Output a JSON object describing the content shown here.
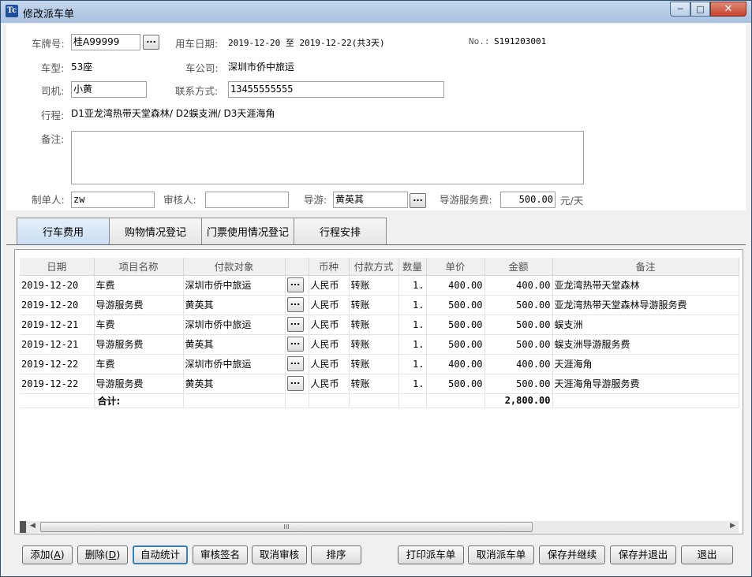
{
  "window": {
    "title": "修改派车单",
    "app_icon": "Tc"
  },
  "form": {
    "plate_label": "车牌号:",
    "plate_value": "桂A99999",
    "date_label": "用车日期:",
    "date_value": "2019-12-20 至 2019-12-22(共3天)",
    "no_label": "No.:",
    "no_value": "S191203001",
    "car_type_label": "车型:",
    "car_type_value": "53座",
    "company_label": "车公司:",
    "company_value": "深圳市侨中旅运",
    "driver_label": "司机:",
    "driver_value": "小黄",
    "contact_label": "联系方式:",
    "contact_value": "13455555555",
    "itinerary_label": "行程:",
    "itinerary_value": "D1亚龙湾热带天堂森林/ D2蜈支洲/ D3天涯海角",
    "remark_label": "备注:",
    "remark_value": "",
    "maker_label": "制单人:",
    "maker_value": "zw",
    "reviewer_label": "审核人:",
    "reviewer_value": "",
    "guide_label": "导游:",
    "guide_value": "黄英其",
    "guide_fee_label": "导游服务费:",
    "guide_fee_value": "500.00",
    "guide_fee_unit": "元/天",
    "ellipsis": "..."
  },
  "tabs": [
    {
      "label": "行车费用",
      "active": true
    },
    {
      "label": "购物情况登记",
      "active": false
    },
    {
      "label": "门票使用情况登记",
      "active": false
    },
    {
      "label": "行程安排",
      "active": false
    }
  ],
  "grid": {
    "columns": [
      "日期",
      "项目名称",
      "付款对象",
      "",
      "币种",
      "付款方式",
      "数量",
      "单价",
      "金额",
      "备注"
    ],
    "rows": [
      [
        "2019-12-20",
        "车费",
        "深圳市侨中旅运",
        "...",
        "人民币",
        "转账",
        "1.",
        "400.00",
        "400.00",
        "亚龙湾热带天堂森林"
      ],
      [
        "2019-12-20",
        "导游服务费",
        "黄英其",
        "...",
        "人民币",
        "转账",
        "1.",
        "500.00",
        "500.00",
        "亚龙湾热带天堂森林导游服务费"
      ],
      [
        "2019-12-21",
        "车费",
        "深圳市侨中旅运",
        "...",
        "人民币",
        "转账",
        "1.",
        "500.00",
        "500.00",
        "蜈支洲"
      ],
      [
        "2019-12-21",
        "导游服务费",
        "黄英其",
        "...",
        "人民币",
        "转账",
        "1.",
        "500.00",
        "500.00",
        "蜈支洲导游服务费"
      ],
      [
        "2019-12-22",
        "车费",
        "深圳市侨中旅运",
        "...",
        "人民币",
        "转账",
        "1.",
        "400.00",
        "400.00",
        "天涯海角"
      ],
      [
        "2019-12-22",
        "导游服务费",
        "黄英其",
        "...",
        "人民币",
        "转账",
        "1.",
        "500.00",
        "500.00",
        "天涯海角导游服务费"
      ]
    ],
    "total_label": "合计:",
    "total_amount": "2,800.00",
    "scroll_grip": "III"
  },
  "buttons": {
    "add": {
      "text": "添加(",
      "key": "A",
      "tail": ")"
    },
    "delete": {
      "text": "删除(",
      "key": "D",
      "tail": ")"
    },
    "auto_stat": "自动统计",
    "approve": "审核签名",
    "cancel_approve": "取消审核",
    "sort": "排序",
    "print": "打印派车单",
    "cancel_order": "取消派车单",
    "save_continue": "保存并继续",
    "save_exit": "保存并退出",
    "exit": "退出"
  }
}
